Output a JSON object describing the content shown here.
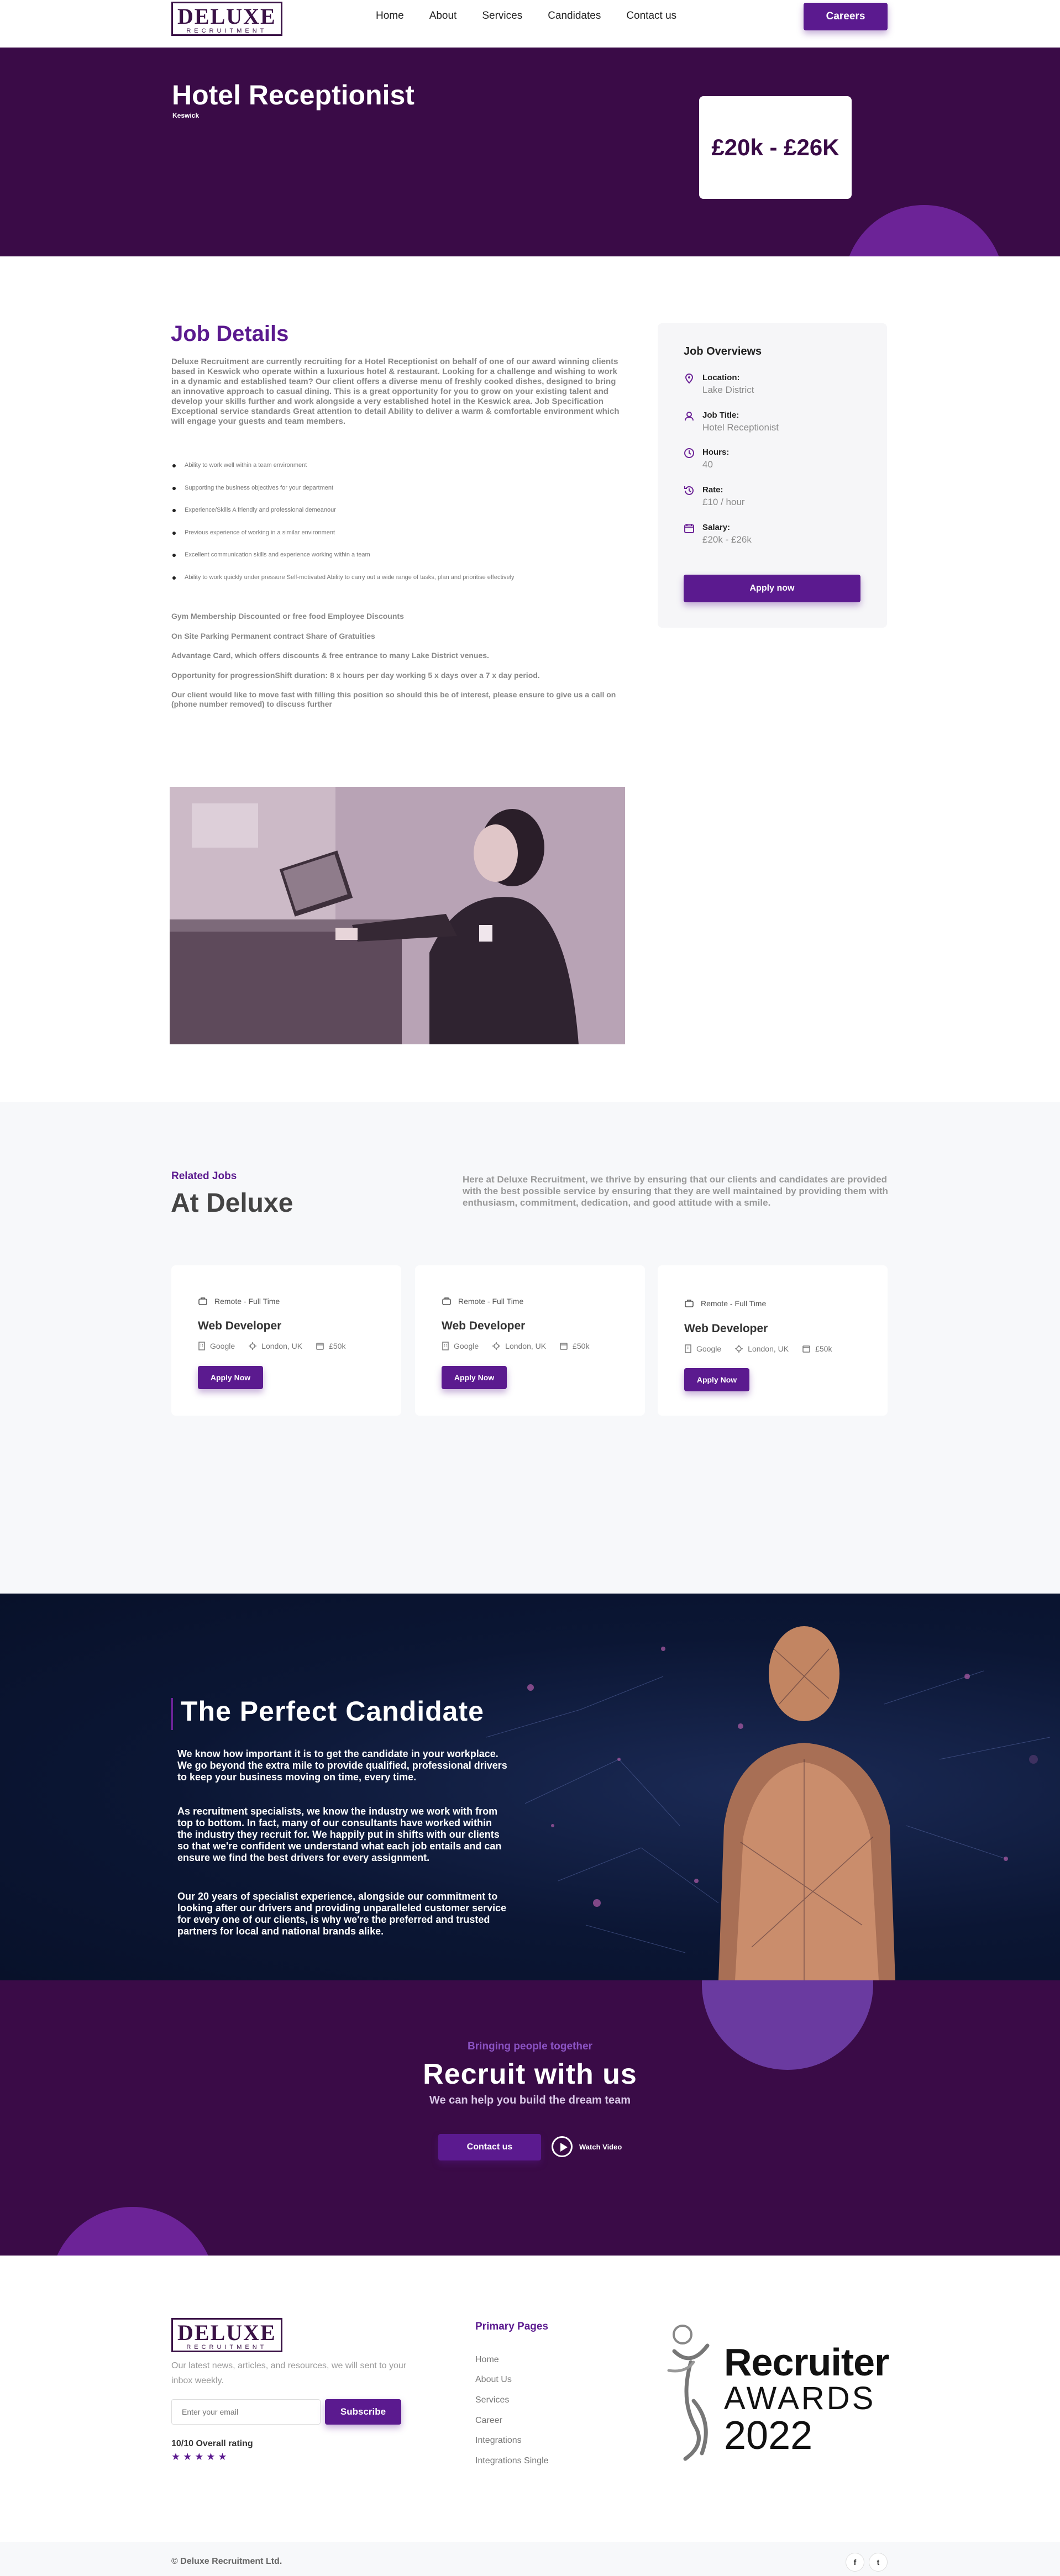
{
  "header": {
    "logo_main": "DELUXE",
    "logo_sub": "RECRUITMENT",
    "nav": [
      "Home",
      "About",
      "Services",
      "Candidates",
      "Contact us"
    ],
    "careers_label": "Careers"
  },
  "hero": {
    "title": "Hotel Receptionist",
    "location": "Keswick",
    "salary": "£20k - £26K"
  },
  "job_details": {
    "title": "Job Details",
    "intro": "Deluxe Recruitment are currently recruiting for a Hotel Receptionist on behalf of one of our award winning clients based in Keswick who operate within a luxurious hotel & restaurant. Looking for a challenge and wishing to work in a dynamic and established team? Our client offers a diverse menu of freshly cooked dishes, designed to bring an innovative approach to casual dining. This is a great opportunity for you to grow on your existing talent and develop your skills further and work alongside a very established hotel in the Keswick area. Job Specification Exceptional service standards Great attention to detail Ability to deliver a warm & comfortable environment which will engage your guests and team members.",
    "bullets": [
      "Ability to work well within a team environment",
      "Supporting the business objectives for your department",
      "Experience/Skills A friendly and professional demeanour",
      "Previous experience of working in a similar environment",
      "Excellent communication skills and experience working within a team",
      "Ability to work quickly under pressure Self-motivated Ability to carry out a wide range of tasks, plan and prioritise effectively"
    ],
    "paragraphs": [
      "Gym Membership Discounted or free food Employee Discounts",
      "On Site Parking Permanent contract Share of Gratuities",
      "Advantage Card, which offers discounts & free entrance to many Lake District venues.",
      "Opportunity for progressionShift duration: 8 x hours per day working 5 x days over a 7 x day period.",
      "Our client would like to move fast with filling this position so should this be of interest, please ensure to give us a call on (phone number removed) to discuss further"
    ]
  },
  "overview": {
    "title": "Job Overviews",
    "items": [
      {
        "icon": "location-pin-icon",
        "label": "Location:",
        "value": "Lake District"
      },
      {
        "icon": "user-icon",
        "label": "Job Title:",
        "value": "Hotel Receptionist"
      },
      {
        "icon": "clock-icon",
        "label": "Hours:",
        "value": "40"
      },
      {
        "icon": "history-icon",
        "label": "Rate:",
        "value": "£10 / hour"
      },
      {
        "icon": "calendar-icon",
        "label": "Salary:",
        "value": "£20k - £26k"
      }
    ],
    "apply_label": "Apply now"
  },
  "related": {
    "kicker": "Related Jobs",
    "title": "At Deluxe",
    "description": "Here at Deluxe Recruitment, we thrive by ensuring that our clients and candidates are provided with the best possible service by ensuring that they are well maintained by providing them with enthusiasm, commitment, dedication, and good attitude with a smile.",
    "cards": [
      {
        "type": "Remote - Full Time",
        "title": "Web Developer",
        "company": "Google",
        "location": "London, UK",
        "salary": "£50k",
        "button": "Apply Now"
      },
      {
        "type": "Remote - Full Time",
        "title": "Web Developer",
        "company": "Google",
        "location": "London, UK",
        "salary": "£50k",
        "button": "Apply Now"
      },
      {
        "type": "Remote - Full Time",
        "title": "Web Developer",
        "company": "Google",
        "location": "London, UK",
        "salary": "£50k",
        "button": "Apply Now"
      }
    ]
  },
  "candidate": {
    "title": "The Perfect Candidate",
    "paragraphs": [
      "We know how important it is to get the candidate in your workplace. We go beyond the extra mile to provide qualified, professional drivers to keep your business moving on time, every time.",
      "As recruitment specialists, we know the industry we work with from top to bottom. In fact, many of our consultants have worked within the industry they recruit for. We happily put in shifts with our clients so that we're confident we understand what each job entails and can ensure we find the best drivers for every assignment.",
      "Our 20 years of specialist experience, alongside our commitment to looking after our drivers and providing unparalleled customer service for every one of our clients, is why we're the preferred and trusted partners for local and national brands alike."
    ]
  },
  "recruit": {
    "kicker": "Bringing people together",
    "title": "Recruit with us",
    "subtitle": "We can help you build the dream team",
    "contact_label": "Contact us",
    "watch_label": "Watch Video"
  },
  "footer": {
    "logo_main": "DELUXE",
    "logo_sub": "RECRUITMENT",
    "description": "Our latest news, articles, and resources, we will sent to your inbox weekly.",
    "email_placeholder": "Enter your email",
    "subscribe_label": "Subscribe",
    "rating": "10/10 Overall rating",
    "stars": "★★★★★",
    "primary_title": "Primary Pages",
    "primary_links": [
      "Home",
      "About Us",
      "Services",
      "Career",
      "Integrations",
      "Integrations Single"
    ],
    "award_recruiter": "Recruiter",
    "award_awards": "AWARDS",
    "award_year": "2022",
    "copyright": "© Deluxe Recruitment Ltd.",
    "social": [
      {
        "icon": "facebook-icon",
        "glyph": "f"
      },
      {
        "icon": "twitter-icon",
        "glyph": "t"
      }
    ]
  },
  "colors": {
    "brand_dark": "#3a0b47",
    "brand_purple": "#5b1a8f",
    "accent_circle": "#6c2397"
  }
}
